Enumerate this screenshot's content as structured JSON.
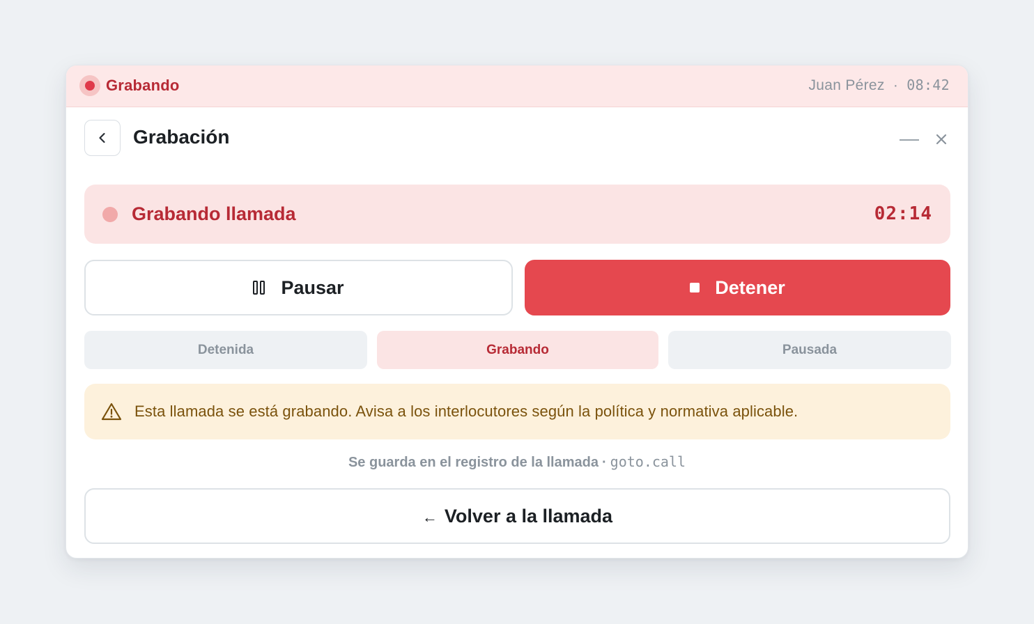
{
  "recording_bar": {
    "label": "Grabando",
    "user": "Juan Pérez",
    "separator": "·",
    "clock": "08:42"
  },
  "header": {
    "title": "Grabación",
    "back_icon": "chevron-left-icon",
    "minimize_icon": "minimize-icon",
    "close_icon": "close-icon"
  },
  "status": {
    "text": "Grabando llamada",
    "timer": "02:14"
  },
  "actions": {
    "pause_label": "Pausar",
    "pause_icon": "pause-icon",
    "stop_label": "Detener",
    "stop_icon": "stop-icon"
  },
  "states": [
    {
      "label": "Detenida",
      "active": false
    },
    {
      "label": "Grabando",
      "active": true
    },
    {
      "label": "Pausada",
      "active": false
    }
  ],
  "warning": {
    "icon": "warning-icon",
    "text": "Esta llamada se está grabando. Avisa a los interlocutores según la política y normativa aplicable."
  },
  "note": {
    "text": "Se guarda en el registro de la llamada",
    "separator": "·",
    "domain": "goto.call"
  },
  "return_button": {
    "arrow": "←",
    "label": "Volver a la llamada"
  },
  "colors": {
    "accent_red": "#e5484f",
    "recording_text": "#b72a35",
    "warning_text": "#7a520c",
    "warning_bg": "#fdf1dc"
  }
}
